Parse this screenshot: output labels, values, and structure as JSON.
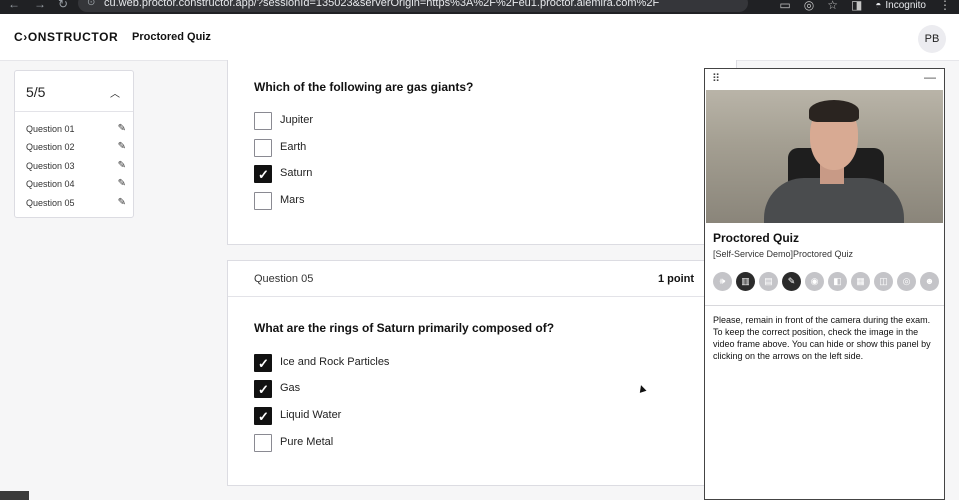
{
  "browser": {
    "back": "←",
    "forward": "→",
    "reload": "↻",
    "url": "cu.web.proctor.constructor.app/?sessionId=135023&serverOrigin=https%3A%2F%2Feu1.proctor.alemira.com%2F",
    "incognito_label": "Incognito"
  },
  "header": {
    "logo": "C›ONSTRUCTOR",
    "title": "Proctored Quiz",
    "avatar_initials": "PB"
  },
  "navigator": {
    "progress": "5/5",
    "items": [
      {
        "label": "Question 01"
      },
      {
        "label": "Question 02"
      },
      {
        "label": "Question 03"
      },
      {
        "label": "Question 04"
      },
      {
        "label": "Question 05"
      }
    ]
  },
  "question4": {
    "text": "Which of the following are gas giants?",
    "options": [
      {
        "label": "Jupiter",
        "checked": false
      },
      {
        "label": "Earth",
        "checked": false
      },
      {
        "label": "Saturn",
        "checked": true
      },
      {
        "label": "Mars",
        "checked": false
      }
    ]
  },
  "question5": {
    "label": "Question 05",
    "points": "1 point",
    "text": "What are the rings of Saturn primarily composed of?",
    "options": [
      {
        "label": "Ice and Rock Particles",
        "checked": true
      },
      {
        "label": "Gas",
        "checked": true
      },
      {
        "label": "Liquid Water",
        "checked": true
      },
      {
        "label": "Pure Metal",
        "checked": false
      }
    ]
  },
  "proctor": {
    "title": "Proctored Quiz",
    "subtitle": "[Self-Service Demo]Proctored Quiz",
    "status_icons": [
      {
        "name": "microphone-icon",
        "active": false
      },
      {
        "name": "book-icon",
        "active": true
      },
      {
        "name": "id-card-icon",
        "active": false
      },
      {
        "name": "note-icon",
        "active": true
      },
      {
        "name": "browser-icon",
        "active": false
      },
      {
        "name": "screen-icon",
        "active": false
      },
      {
        "name": "qr-icon",
        "active": false
      },
      {
        "name": "chat-icon",
        "active": false
      },
      {
        "name": "eye-icon",
        "active": false
      },
      {
        "name": "person-icon",
        "active": false
      }
    ],
    "instructions": "Please, remain in front of the camera during the exam. To keep the correct position, check the image in the video frame above. You can hide or show this panel by clicking on the arrows on the left side."
  }
}
